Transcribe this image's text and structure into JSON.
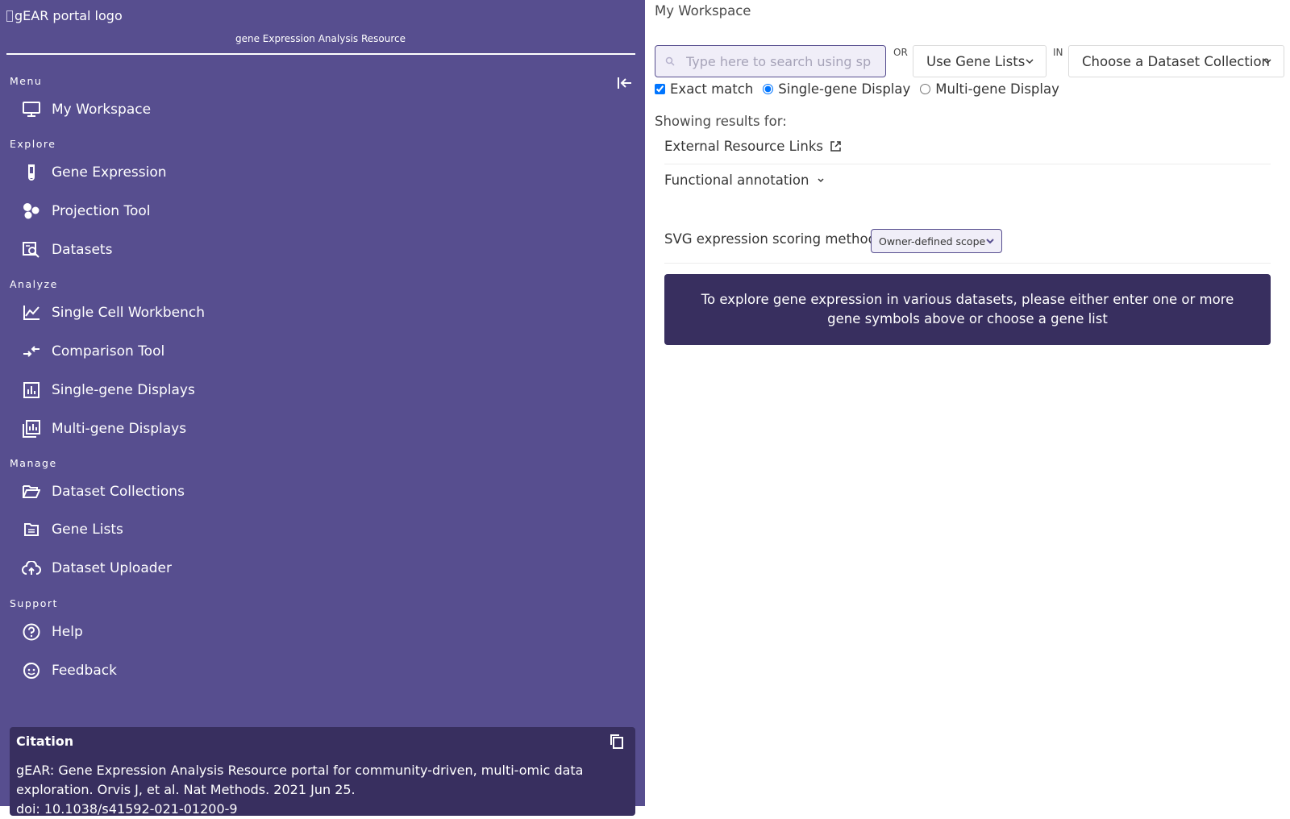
{
  "sidebar": {
    "logo_alt": "gEAR portal logo",
    "subtitle": "gene Expression Analysis Resource",
    "collapse_icon": "collapse-left-icon",
    "sections": {
      "menu": "Menu",
      "explore": "Explore",
      "analyze": "Analyze",
      "manage": "Manage",
      "support": "Support"
    },
    "items": [
      {
        "label": "My Workspace",
        "icon": "monitor-icon"
      },
      {
        "label": "Gene Expression",
        "icon": "test-tube-icon"
      },
      {
        "label": "Projection Tool",
        "icon": "circles-icon"
      },
      {
        "label": "Datasets",
        "icon": "dataset-search-icon"
      },
      {
        "label": "Single Cell Workbench",
        "icon": "line-chart-icon"
      },
      {
        "label": "Comparison Tool",
        "icon": "compare-arrows-icon"
      },
      {
        "label": "Single-gene Displays",
        "icon": "bar-chart-icon"
      },
      {
        "label": "Multi-gene Displays",
        "icon": "multi-chart-icon"
      },
      {
        "label": "Dataset Collections",
        "icon": "folder-open-icon"
      },
      {
        "label": "Gene Lists",
        "icon": "list-box-icon"
      },
      {
        "label": "Dataset Uploader",
        "icon": "cloud-upload-icon"
      },
      {
        "label": "Help",
        "icon": "help-circle-icon"
      },
      {
        "label": "Feedback",
        "icon": "feedback-face-icon"
      }
    ],
    "citation": {
      "title": "Citation",
      "copy_icon": "copy-icon",
      "text": "gEAR: Gene Expression Analysis Resource portal for community-driven, multi-omic data exploration. Orvis J, et al. Nat Methods. 2021 Jun 25.",
      "doi": "doi: 10.1038/s41592-021-01200-9"
    }
  },
  "main": {
    "title": "My Workspace",
    "search": {
      "placeholder": "Type here to search using sp",
      "value": "",
      "icon": "search-icon"
    },
    "or_label": "OR",
    "in_label": "IN",
    "gene_lists_select": "Use Gene Lists",
    "collection_select": "Choose a Dataset Collection",
    "options": {
      "exact_match": "Exact match",
      "exact_match_checked": true,
      "single_gene": "Single-gene Display",
      "multi_gene": "Multi-gene Display",
      "selected_display": "single"
    },
    "showing_results": "Showing results for:",
    "external_links": "External Resource Links",
    "functional_annotation": "Functional annotation",
    "svg_scoring_label": "SVG expression scoring method:",
    "svg_scoring_value": "Owner-defined scope",
    "notice": "To explore gene expression in various datasets, please either enter one or more gene symbols above or choose a gene list"
  },
  "colors": {
    "sidebar_bg": "#574e8f",
    "dark_panel": "#382f5f",
    "accent": "#574e8f"
  }
}
